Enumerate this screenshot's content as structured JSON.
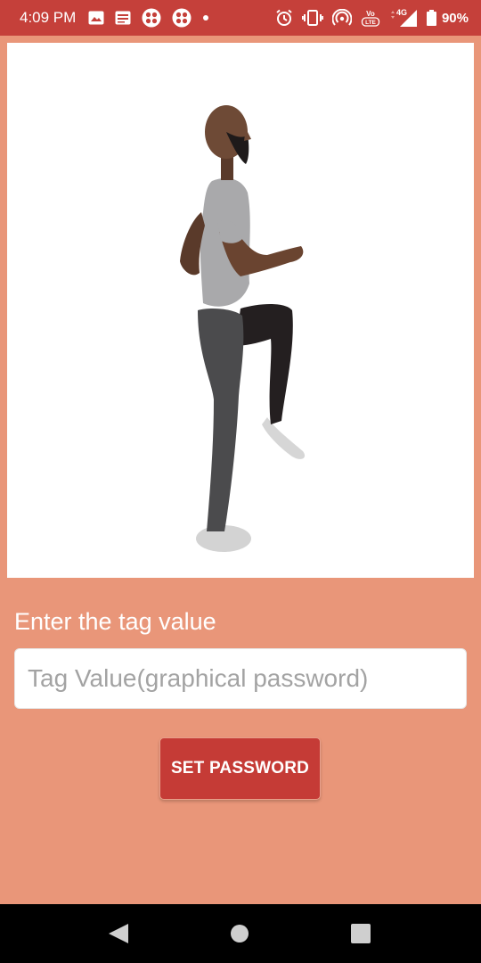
{
  "status_bar": {
    "time": "4:09 PM",
    "battery": "90%",
    "network": "4G",
    "left_icons": [
      "image-icon",
      "news-icon",
      "app-icon",
      "app-icon",
      "dot-icon"
    ],
    "right_icons": [
      "alarm-icon",
      "vibrate-icon",
      "hotspot-icon",
      "volte-icon",
      "signal-icon",
      "battery-icon"
    ]
  },
  "main": {
    "image_subject": "person-marching-animation",
    "tag_label": "Enter the tag value",
    "tag_input": {
      "value": "",
      "placeholder": "Tag Value(graphical password)"
    },
    "set_button_label": "SET PASSWORD"
  },
  "nav_bar": {
    "buttons": [
      "back",
      "home",
      "recents"
    ]
  },
  "colors": {
    "background": "#E99679",
    "status_bar": "#C5403A",
    "button": "#C53B36",
    "label_text": "#FFFFFF"
  }
}
